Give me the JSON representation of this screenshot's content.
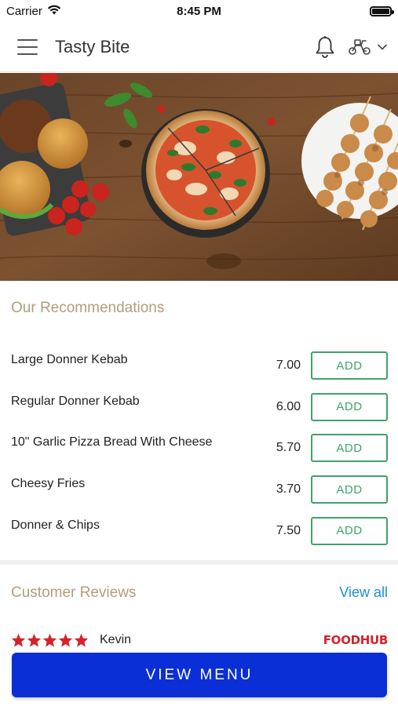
{
  "status_bar": {
    "carrier": "Carrier",
    "time": "8:45 PM"
  },
  "header": {
    "title": "Tasty Bite"
  },
  "recommendations": {
    "title": "Our Recommendations",
    "add_label": "ADD",
    "items": [
      {
        "name": "Large Donner Kebab",
        "price": "7.00"
      },
      {
        "name": "Regular Donner Kebab",
        "price": "6.00"
      },
      {
        "name": "10\" Garlic Pizza Bread With Cheese",
        "price": "5.70"
      },
      {
        "name": "Cheesy Fries",
        "price": "3.70"
      },
      {
        "name": "Donner & Chips",
        "price": "7.50"
      }
    ]
  },
  "reviews": {
    "title": "Customer Reviews",
    "view_all": "View all",
    "first": {
      "reviewer": "Kevin",
      "rating": 5,
      "source": "FOODHUB"
    }
  },
  "footer": {
    "view_menu": "VIEW MENU"
  },
  "colors": {
    "accent_title": "#b29d7b",
    "add_green": "#3fa36a",
    "link_blue": "#1d8fd6",
    "button_blue": "#0b2fd6",
    "star_red": "#d3232a"
  }
}
